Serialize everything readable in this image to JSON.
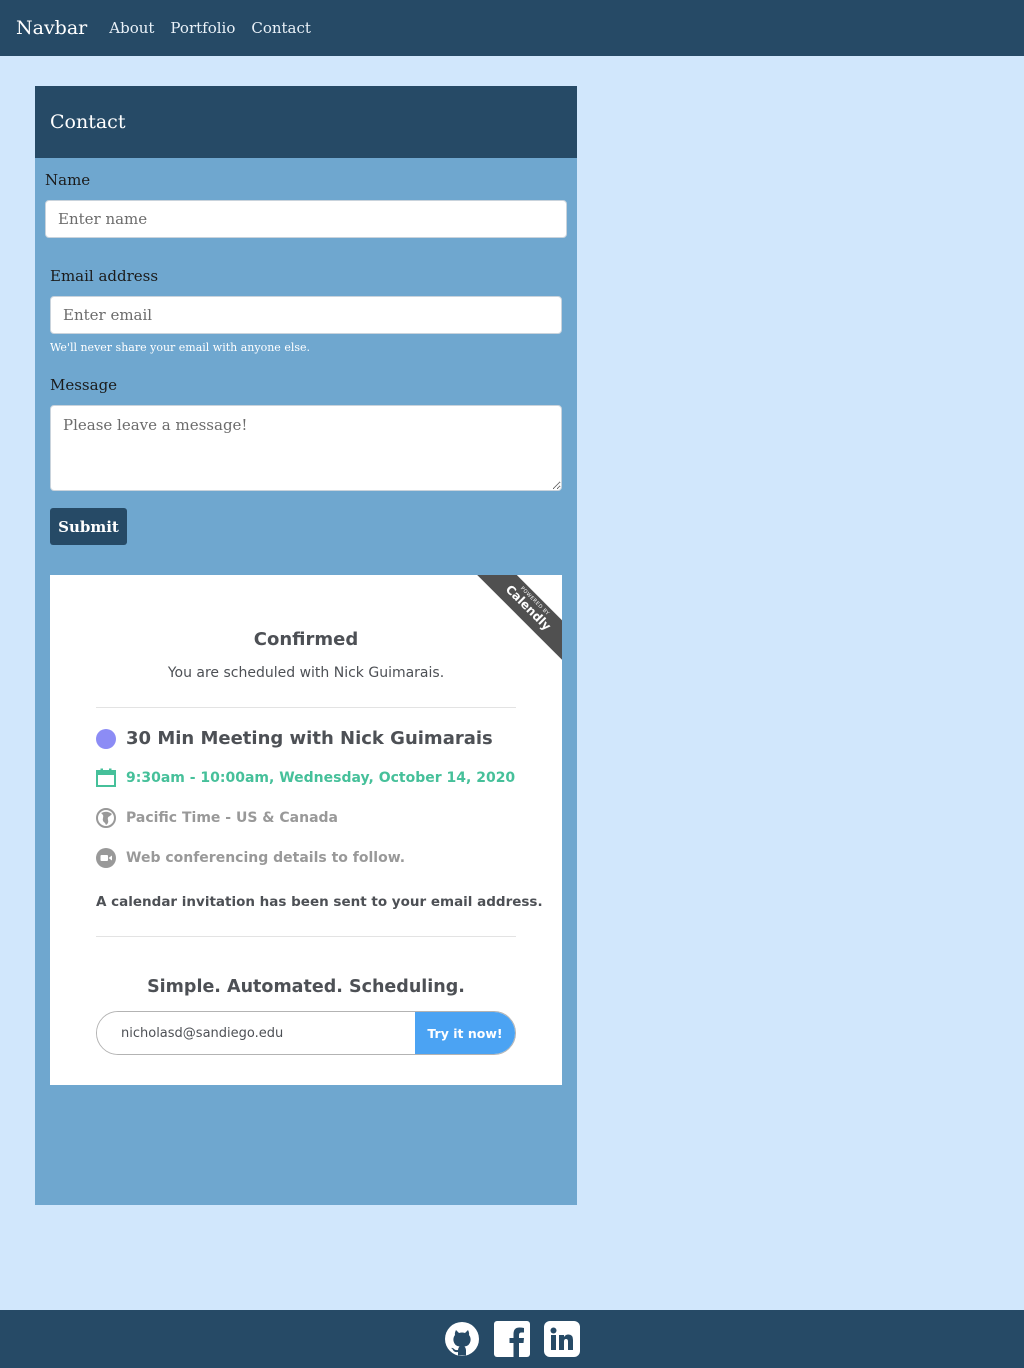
{
  "navbar": {
    "brand": "Navbar",
    "links": [
      "About",
      "Portfolio",
      "Contact"
    ]
  },
  "contact": {
    "header": "Contact",
    "name_label": "Name",
    "name_placeholder": "Enter name",
    "email_label": "Email address",
    "email_placeholder": "Enter email",
    "email_help": "We'll never share your email with anyone else.",
    "message_label": "Message",
    "message_placeholder": "Please leave a message!",
    "submit_label": "Submit"
  },
  "calendly": {
    "ribbon_small": "POWERED BY",
    "ribbon_brand": "Calendly",
    "title": "Confirmed",
    "subtitle": "You are scheduled with Nick Guimarais.",
    "meeting": "30 Min Meeting with Nick Guimarais",
    "time": "9:30am - 10:00am, Wednesday, October 14, 2020",
    "timezone": "Pacific Time - US & Canada",
    "conferencing": "Web conferencing details to follow.",
    "invitation": "A calendar invitation has been sent to your email address.",
    "tagline": "Simple. Automated. Scheduling.",
    "email_value": "nicholasd@sandiego.edu",
    "try_label": "Try it now!",
    "colors": {
      "event_dot": "#8c8cf5",
      "time": "#46c09a",
      "button": "#4ba3f3"
    }
  },
  "footer": {
    "icons": [
      "github-icon",
      "facebook-icon",
      "linkedin-icon"
    ]
  }
}
